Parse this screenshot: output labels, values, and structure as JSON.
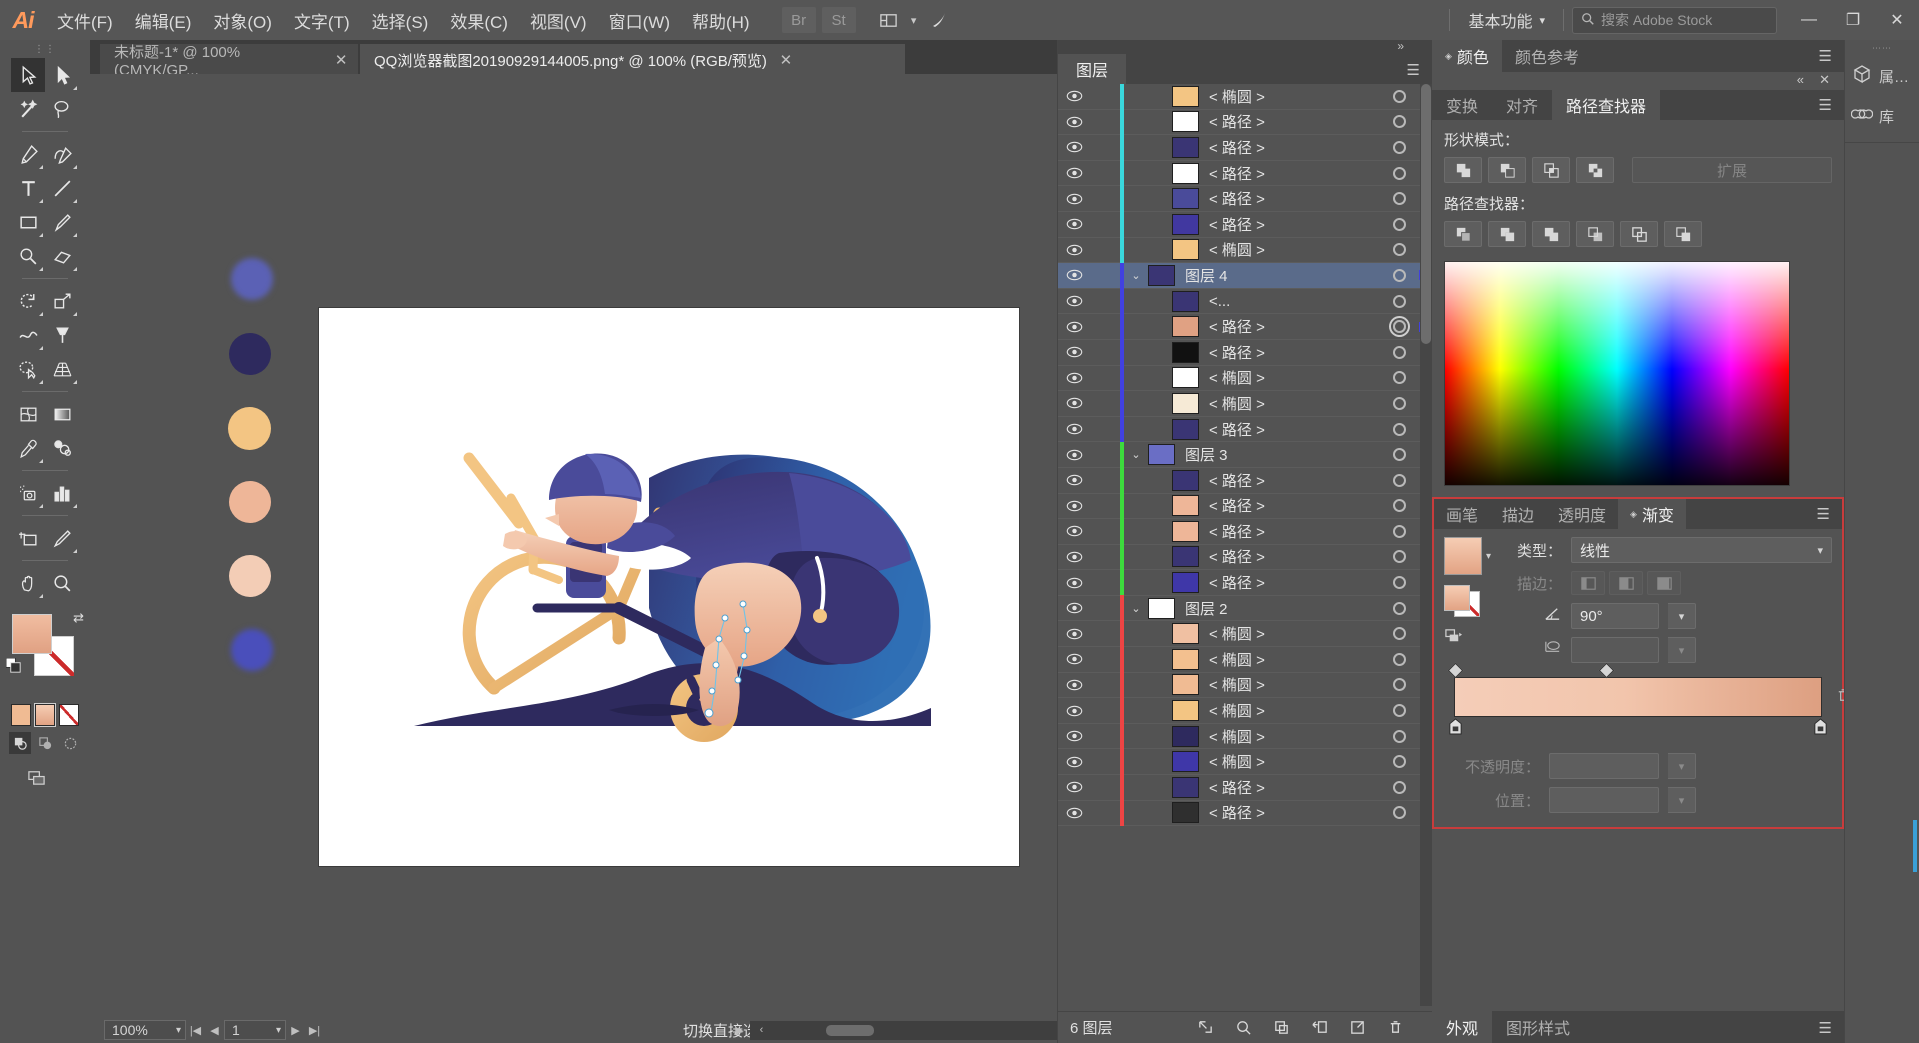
{
  "app": {
    "logo": "Ai",
    "menus": [
      "文件(F)",
      "编辑(E)",
      "对象(O)",
      "文字(T)",
      "选择(S)",
      "效果(C)",
      "视图(V)",
      "窗口(W)",
      "帮助(H)"
    ],
    "bridge_label": "Br",
    "stock_label": "St",
    "workspace": "基本功能",
    "search_placeholder": "搜索 Adobe Stock",
    "win_minimize": "—",
    "win_restore": "❐",
    "win_close": "✕"
  },
  "tabs": [
    {
      "title": "未标题-1* @ 100% (CMYK/GP...",
      "close": "✕",
      "active": false
    },
    {
      "title": "QQ浏览器截图20190929144005.png* @ 100% (RGB/预览)",
      "close": "✕",
      "active": true
    }
  ],
  "toolbar": {
    "handle": "||",
    "tools": [
      {
        "name": "selection-tool",
        "icon": "arrow",
        "selected": true,
        "corner": false
      },
      {
        "name": "direct-selection-tool",
        "icon": "arrow-white",
        "selected": false,
        "corner": true
      },
      {
        "name": "magic-wand-tool",
        "icon": "wand",
        "selected": false,
        "corner": false
      },
      {
        "name": "lasso-tool",
        "icon": "lasso",
        "selected": false,
        "corner": false
      },
      {
        "name": "pen-tool",
        "icon": "pen",
        "selected": false,
        "corner": true
      },
      {
        "name": "curvature-tool",
        "icon": "curvature",
        "selected": false,
        "corner": true
      },
      {
        "name": "type-tool",
        "icon": "type",
        "selected": false,
        "corner": true
      },
      {
        "name": "line-segment-tool",
        "icon": "line",
        "selected": false,
        "corner": true
      },
      {
        "name": "rectangle-tool",
        "icon": "rect",
        "selected": false,
        "corner": true
      },
      {
        "name": "paintbrush-tool",
        "icon": "brush",
        "selected": false,
        "corner": true
      },
      {
        "name": "shaper-tool",
        "icon": "shaper",
        "selected": false,
        "corner": true
      },
      {
        "name": "eraser-tool",
        "icon": "eraser",
        "selected": false,
        "corner": true
      },
      {
        "name": "rotate-tool",
        "icon": "rotate",
        "selected": false,
        "corner": true
      },
      {
        "name": "scale-tool",
        "icon": "scale",
        "selected": false,
        "corner": true
      },
      {
        "name": "width-tool",
        "icon": "width",
        "selected": false,
        "corner": true
      },
      {
        "name": "free-transform-tool",
        "icon": "pushpin",
        "selected": false,
        "corner": false
      },
      {
        "name": "shape-builder-tool",
        "icon": "shapebuilder",
        "selected": false,
        "corner": true
      },
      {
        "name": "perspective-grid-tool",
        "icon": "perspective",
        "selected": false,
        "corner": true
      },
      {
        "name": "mesh-tool",
        "icon": "mesh",
        "selected": false,
        "corner": false
      },
      {
        "name": "gradient-tool",
        "icon": "gradient",
        "selected": false,
        "corner": false
      },
      {
        "name": "eyedropper-tool",
        "icon": "eyedropper",
        "selected": false,
        "corner": true
      },
      {
        "name": "blend-tool",
        "icon": "blend",
        "selected": false,
        "corner": false
      },
      {
        "name": "symbol-sprayer-tool",
        "icon": "symbolspray",
        "selected": false,
        "corner": true
      },
      {
        "name": "column-graph-tool",
        "icon": "graph",
        "selected": false,
        "corner": true
      },
      {
        "name": "artboard-tool",
        "icon": "artboard",
        "selected": false,
        "corner": false
      },
      {
        "name": "slice-tool",
        "icon": "slice",
        "selected": false,
        "corner": true
      },
      {
        "name": "hand-tool",
        "icon": "hand",
        "selected": false,
        "corner": true
      },
      {
        "name": "zoom-tool",
        "icon": "zoom",
        "selected": false,
        "corner": false
      }
    ],
    "fill_color": "#e8ab8c",
    "stroke_color": "#ffffff",
    "swatch_mode": [
      "fill-color",
      "gradient",
      "none"
    ],
    "draw_modes": [
      "draw-normal",
      "draw-behind",
      "draw-inside"
    ]
  },
  "canvas": {
    "palette_dots": [
      {
        "color": "#5b61b5",
        "blurred": true
      },
      {
        "color": "#2e2a5e",
        "blurred": false
      },
      {
        "color": "#f3c583",
        "blurred": false
      },
      {
        "color": "#eeb698",
        "blurred": false
      },
      {
        "color": "#f3cdb6",
        "blurred": false
      },
      {
        "color": "#4a4fbb",
        "blurred": true
      }
    ],
    "artwork_alt": "cyclist on exercise bike illustration"
  },
  "statusbar": {
    "zoom": "100%",
    "page": "1",
    "status_text": "切换直接选择"
  },
  "layers_panel": {
    "tab": "图层",
    "footer_count": "6 图层",
    "footer_buttons": [
      "locate-object",
      "make-clipping-mask",
      "create-new-sublayer",
      "create-new-layer",
      "delete-selection"
    ],
    "rows": [
      {
        "indent": 1,
        "color": "#3ad8dd",
        "thumb": "#f3c583",
        "name": "< 椭圆 >",
        "selected": false,
        "twirl": false,
        "target_double": false,
        "sel_sq": null
      },
      {
        "indent": 1,
        "color": "#3ad8dd",
        "thumb": "#ffffff",
        "name": "< 路径 >",
        "selected": false,
        "twirl": false,
        "target_double": false,
        "sel_sq": null
      },
      {
        "indent": 1,
        "color": "#3ad8dd",
        "thumb": "#3a3574",
        "name": "< 路径 >",
        "selected": false,
        "twirl": false,
        "target_double": false,
        "sel_sq": null
      },
      {
        "indent": 1,
        "color": "#3ad8dd",
        "thumb": "#ffffff",
        "name": "< 路径 >",
        "selected": false,
        "twirl": false,
        "target_double": false,
        "sel_sq": null
      },
      {
        "indent": 1,
        "color": "#3ad8dd",
        "thumb": "#4a4b9a",
        "name": "< 路径 >",
        "selected": false,
        "twirl": false,
        "target_double": false,
        "sel_sq": null
      },
      {
        "indent": 1,
        "color": "#3ad8dd",
        "thumb": "#4138a0",
        "name": "< 路径 >",
        "selected": false,
        "twirl": false,
        "target_double": false,
        "sel_sq": null
      },
      {
        "indent": 1,
        "color": "#3ad8dd",
        "thumb": "#f3c583",
        "name": "< 椭圆 >",
        "selected": false,
        "twirl": false,
        "target_double": false,
        "sel_sq": null
      },
      {
        "indent": 0,
        "color": "#4141e0",
        "thumb": "#3a3574",
        "name": "图层 4",
        "selected": true,
        "twirl": true,
        "target_double": false,
        "sel_sq": "#4141e0"
      },
      {
        "indent": 1,
        "color": "#4141e0",
        "thumb": "#3a3574",
        "name": "<...",
        "selected": false,
        "twirl": false,
        "target_double": false,
        "sel_sq": null
      },
      {
        "indent": 1,
        "color": "#4141e0",
        "thumb": "#e0a183",
        "name": "< 路径 >",
        "selected": false,
        "twirl": false,
        "target_double": true,
        "sel_sq": "#4141e0"
      },
      {
        "indent": 1,
        "color": "#4141e0",
        "thumb": "#111111",
        "name": "< 路径 >",
        "selected": false,
        "twirl": false,
        "target_double": false,
        "sel_sq": null
      },
      {
        "indent": 1,
        "color": "#4141e0",
        "thumb": "#ffffff",
        "name": "< 椭圆 >",
        "selected": false,
        "twirl": false,
        "target_double": false,
        "sel_sq": null
      },
      {
        "indent": 1,
        "color": "#4141e0",
        "thumb": "#f6ead6",
        "name": "< 椭圆 >",
        "selected": false,
        "twirl": false,
        "target_double": false,
        "sel_sq": null
      },
      {
        "indent": 1,
        "color": "#4141e0",
        "thumb": "#3a3574",
        "name": "< 路径 >",
        "selected": false,
        "twirl": false,
        "target_double": false,
        "sel_sq": null
      },
      {
        "indent": 0,
        "color": "#3ddb3d",
        "thumb": "#6a6ec5",
        "name": "图层 3",
        "selected": false,
        "twirl": true,
        "target_double": false,
        "sel_sq": null
      },
      {
        "indent": 1,
        "color": "#3ddb3d",
        "thumb": "#3a3574",
        "name": "< 路径 >",
        "selected": false,
        "twirl": false,
        "target_double": false,
        "sel_sq": null
      },
      {
        "indent": 1,
        "color": "#3ddb3d",
        "thumb": "#eeb698",
        "name": "< 路径 >",
        "selected": false,
        "twirl": false,
        "target_double": false,
        "sel_sq": null
      },
      {
        "indent": 1,
        "color": "#3ddb3d",
        "thumb": "#eeb698",
        "name": "< 路径 >",
        "selected": false,
        "twirl": false,
        "target_double": false,
        "sel_sq": null
      },
      {
        "indent": 1,
        "color": "#3ddb3d",
        "thumb": "#3a3574",
        "name": "< 路径 >",
        "selected": false,
        "twirl": false,
        "target_double": false,
        "sel_sq": null
      },
      {
        "indent": 1,
        "color": "#3ddb3d",
        "thumb": "#3f37a8",
        "name": "< 路径 >",
        "selected": false,
        "twirl": false,
        "target_double": false,
        "sel_sq": null
      },
      {
        "indent": 0,
        "color": "#ee4444",
        "thumb": "#ffffff",
        "name": "图层 2",
        "selected": false,
        "twirl": true,
        "target_double": false,
        "sel_sq": null
      },
      {
        "indent": 1,
        "color": "#ee4444",
        "thumb": "#f0c0a2",
        "name": "< 椭圆 >",
        "selected": false,
        "twirl": false,
        "target_double": false,
        "sel_sq": null
      },
      {
        "indent": 1,
        "color": "#ee4444",
        "thumb": "#f3c08f",
        "name": "< 椭圆 >",
        "selected": false,
        "twirl": false,
        "target_double": false,
        "sel_sq": null
      },
      {
        "indent": 1,
        "color": "#ee4444",
        "thumb": "#f0bb93",
        "name": "< 椭圆 >",
        "selected": false,
        "twirl": false,
        "target_double": false,
        "sel_sq": null
      },
      {
        "indent": 1,
        "color": "#ee4444",
        "thumb": "#f3c583",
        "name": "< 椭圆 >",
        "selected": false,
        "twirl": false,
        "target_double": false,
        "sel_sq": null
      },
      {
        "indent": 1,
        "color": "#ee4444",
        "thumb": "#2e2a5e",
        "name": "< 椭圆 >",
        "selected": false,
        "twirl": false,
        "target_double": false,
        "sel_sq": null
      },
      {
        "indent": 1,
        "color": "#ee4444",
        "thumb": "#3f37a8",
        "name": "< 椭圆 >",
        "selected": false,
        "twirl": false,
        "target_double": false,
        "sel_sq": null
      },
      {
        "indent": 1,
        "color": "#ee4444",
        "thumb": "#3a3574",
        "name": "< 路径 >",
        "selected": false,
        "twirl": false,
        "target_double": false,
        "sel_sq": null
      },
      {
        "indent": 1,
        "color": "#ee4444",
        "thumb": "#2f2f2f",
        "name": "< 路径 >",
        "selected": false,
        "twirl": false,
        "target_double": false,
        "sel_sq": null
      }
    ]
  },
  "color_panel": {
    "tabs": [
      {
        "label": "颜色",
        "active": true,
        "diamond": true
      },
      {
        "label": "颜色参考",
        "active": false,
        "diamond": false
      }
    ]
  },
  "pathfinder_panel": {
    "tabs": [
      {
        "label": "变换",
        "active": false
      },
      {
        "label": "对齐",
        "active": false
      },
      {
        "label": "路径查找器",
        "active": true
      }
    ],
    "shape_modes_label": "形状模式：",
    "shape_modes": [
      "unite",
      "minus-front",
      "intersect",
      "exclude"
    ],
    "expand_label": "扩展",
    "pathfinders_label": "路径查找器：",
    "pathfinders": [
      "divide",
      "trim",
      "merge",
      "crop",
      "outline",
      "minus-back"
    ]
  },
  "gradient_panel": {
    "tabs": [
      {
        "label": "画笔",
        "active": false,
        "diamond": false
      },
      {
        "label": "描边",
        "active": false,
        "diamond": false
      },
      {
        "label": "透明度",
        "active": false,
        "diamond": false
      },
      {
        "label": "渐变",
        "active": true,
        "diamond": true
      }
    ],
    "type_label": "类型：",
    "type_value": "线性",
    "stroke_label": "描边：",
    "angle_value": "90°",
    "opacity_label": "不透明度：",
    "opacity_value": "",
    "position_label": "位置：",
    "position_value": "",
    "gradient_start": "#f4cdb8",
    "gradient_end": "#dd9f81",
    "delete_label": "delete-stop"
  },
  "bottom_panel": {
    "tabs": [
      {
        "label": "外观",
        "active": true
      },
      {
        "label": "图形样式",
        "active": false
      }
    ]
  },
  "far_dock": {
    "items": [
      {
        "label": "属…",
        "icon": "properties-icon"
      },
      {
        "label": "库",
        "icon": "libraries-icon"
      }
    ]
  }
}
